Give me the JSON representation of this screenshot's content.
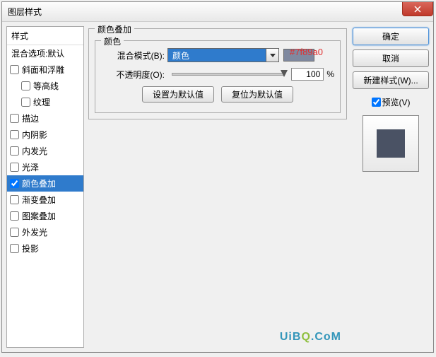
{
  "window": {
    "title": "图层样式"
  },
  "styles_panel": {
    "header": "样式",
    "items": [
      {
        "label": "混合选项:默认",
        "type": "blend"
      },
      {
        "label": "斜面和浮雕",
        "checked": false
      },
      {
        "label": "等高线",
        "checked": false,
        "indent": true
      },
      {
        "label": "纹理",
        "checked": false,
        "indent": true
      },
      {
        "label": "描边",
        "checked": false
      },
      {
        "label": "内阴影",
        "checked": false
      },
      {
        "label": "内发光",
        "checked": false
      },
      {
        "label": "光泽",
        "checked": false
      },
      {
        "label": "颜色叠加",
        "checked": true,
        "selected": true
      },
      {
        "label": "渐变叠加",
        "checked": false
      },
      {
        "label": "图案叠加",
        "checked": false
      },
      {
        "label": "外发光",
        "checked": false
      },
      {
        "label": "投影",
        "checked": false
      }
    ]
  },
  "settings": {
    "group_title": "颜色叠加",
    "color_group": "颜色",
    "hex_note": "#7f89a0",
    "blend_mode_label": "混合模式(B):",
    "blend_mode_value": "颜色",
    "opacity_label": "不透明度(O):",
    "opacity_value": "100",
    "opacity_unit": "%",
    "set_default": "设置为默认值",
    "reset_default": "复位为默认值",
    "overlay_color": "#7f89a0"
  },
  "right": {
    "ok": "确定",
    "cancel": "取消",
    "new_style": "新建样式(W)...",
    "preview_label": "预览(V)",
    "preview_checked": true,
    "preview_color": "#4a5264"
  },
  "watermark": {
    "text_a": "UiB",
    "text_q": "Q",
    "text_b": ".CoM"
  }
}
